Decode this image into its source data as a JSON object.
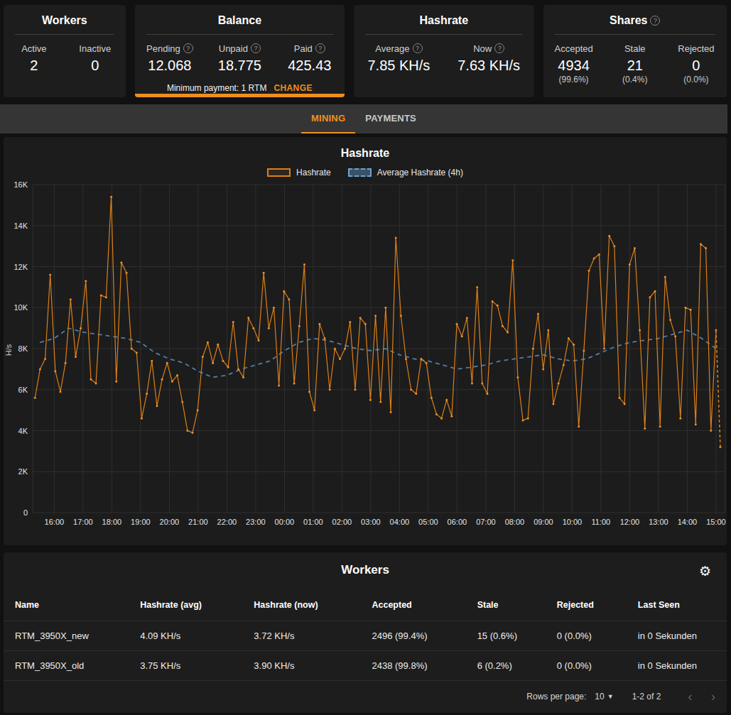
{
  "cards": {
    "workers": {
      "title": "Workers",
      "stats": [
        {
          "label": "Active",
          "value": "2"
        },
        {
          "label": "Inactive",
          "value": "0"
        }
      ]
    },
    "balance": {
      "title": "Balance",
      "stats": [
        {
          "label": "Pending",
          "value": "12.068",
          "help": true
        },
        {
          "label": "Unpaid",
          "value": "18.775",
          "help": true
        },
        {
          "label": "Paid",
          "value": "425.43",
          "help": true
        }
      ],
      "minimum_label": "Minimum payment: 1 RTM",
      "change_label": "CHANGE"
    },
    "hashrate": {
      "title": "Hashrate",
      "stats": [
        {
          "label": "Average",
          "value": "7.85 KH/s",
          "help": true
        },
        {
          "label": "Now",
          "value": "7.63 KH/s",
          "help": true
        }
      ]
    },
    "shares": {
      "title": "Shares",
      "title_help": true,
      "stats": [
        {
          "label": "Accepted",
          "value": "4934",
          "sub": "(99.6%)"
        },
        {
          "label": "Stale",
          "value": "21",
          "sub": "(0.4%)"
        },
        {
          "label": "Rejected",
          "value": "0",
          "sub": "(0.0%)"
        }
      ]
    }
  },
  "tabs": [
    {
      "label": "MINING",
      "active": true
    },
    {
      "label": "PAYMENTS",
      "active": false
    }
  ],
  "chart_data": {
    "type": "line",
    "title": "Hashrate",
    "ylabel": "H/s",
    "ylim": [
      0,
      16000
    ],
    "ytick_labels": [
      "0",
      "2K",
      "4K",
      "6K",
      "8K",
      "10K",
      "12K",
      "14K",
      "16K"
    ],
    "xtick_labels": [
      "16:00",
      "17:00",
      "18:00",
      "19:00",
      "20:00",
      "21:00",
      "22:00",
      "23:00",
      "00:00",
      "01:00",
      "02:00",
      "03:00",
      "04:00",
      "05:00",
      "06:00",
      "07:00",
      "08:00",
      "09:00",
      "10:00",
      "11:00",
      "12:00",
      "13:00",
      "14:00",
      "15:00"
    ],
    "xtick_hours": [
      16,
      17,
      18,
      19,
      20,
      21,
      22,
      23,
      24,
      25,
      26,
      27,
      28,
      29,
      30,
      31,
      32,
      33,
      34,
      35,
      36,
      37,
      38,
      39
    ],
    "legend": [
      {
        "label": "Hashrate",
        "color": "#dd7f17",
        "dashed": false
      },
      {
        "label": "Average Hashrate (4h)",
        "color": "#5487b8",
        "dashed": true
      }
    ],
    "series": [
      {
        "name": "Hashrate",
        "color": "#dd7f17",
        "t_start": 15.33,
        "t_end": 39.0,
        "unit": "H/s",
        "values_khs": [
          5.6,
          7.0,
          7.5,
          11.6,
          6.9,
          5.9,
          7.3,
          10.4,
          7.6,
          9.0,
          11.3,
          6.5,
          6.3,
          10.6,
          10.5,
          15.4,
          6.4,
          12.2,
          11.7,
          8.0,
          7.8,
          4.6,
          5.8,
          7.4,
          5.2,
          6.5,
          7.3,
          6.4,
          6.7,
          5.4,
          4.0,
          3.9,
          5.0,
          7.6,
          8.3,
          7.3,
          8.2,
          7.4,
          7.1,
          9.3,
          7.0,
          6.6,
          9.5,
          9.0,
          8.4,
          11.7,
          9.0,
          10.0,
          6.2,
          10.8,
          10.4,
          6.3,
          9.1,
          12.1,
          5.9,
          5.0,
          9.2,
          8.5,
          6.0,
          8.0,
          7.5,
          8.0,
          9.3,
          6.0,
          9.5,
          9.2,
          5.5,
          9.6,
          5.4,
          10.0,
          4.9,
          13.4,
          9.6,
          7.5,
          6.0,
          5.8,
          7.5,
          7.3,
          5.6,
          4.8,
          4.6,
          5.5,
          4.7,
          9.2,
          8.6,
          9.5,
          6.3,
          11.0,
          6.3,
          5.8,
          10.3,
          10.1,
          9.1,
          8.8,
          12.3,
          6.6,
          4.5,
          4.6,
          8.0,
          9.7,
          7.0,
          8.9,
          5.3,
          6.3,
          7.2,
          8.5,
          8.2,
          4.2,
          7.9,
          11.8,
          12.4,
          12.6,
          8.0,
          13.5,
          13.0,
          5.6,
          5.3,
          12.1,
          12.9,
          8.9,
          4.1,
          10.5,
          10.8,
          4.2,
          11.5,
          9.4,
          8.6,
          4.6,
          10.0,
          9.9,
          4.3,
          13.1,
          12.9,
          4.0,
          8.9
        ]
      },
      {
        "name": "Average Hashrate (4h)",
        "color": "#4d7fad",
        "dashed": true,
        "t_start": 15.5,
        "t_step": 0.5,
        "values_khs": [
          8.3,
          8.5,
          9.0,
          8.8,
          8.7,
          8.6,
          8.5,
          8.3,
          7.8,
          7.5,
          7.3,
          6.9,
          6.6,
          6.7,
          7.0,
          7.2,
          7.4,
          7.9,
          8.3,
          8.5,
          8.4,
          8.2,
          8.0,
          7.9,
          8.0,
          7.7,
          7.5,
          7.4,
          7.2,
          7.0,
          7.1,
          7.2,
          7.4,
          7.5,
          7.6,
          7.7,
          7.5,
          7.4,
          7.5,
          7.8,
          8.1,
          8.3,
          8.4,
          8.5,
          8.7,
          8.9,
          8.5,
          8.0
        ]
      }
    ],
    "trailing_dashed_point": {
      "t": 39.15,
      "value_khs": 3.2
    }
  },
  "workers_table": {
    "title": "Workers",
    "columns": [
      "Name",
      "Hashrate (avg)",
      "Hashrate (now)",
      "Accepted",
      "Stale",
      "Rejected",
      "Last Seen"
    ],
    "rows": [
      [
        "RTM_3950X_new",
        "4.09 KH/s",
        "3.72 KH/s",
        "2496 (99.4%)",
        "15 (0.6%)",
        "0 (0.0%)",
        "in 0 Sekunden"
      ],
      [
        "RTM_3950X_old",
        "3.75 KH/s",
        "3.90 KH/s",
        "2438 (99.8%)",
        "6 (0.2%)",
        "0 (0.0%)",
        "in 0 Sekunden"
      ]
    ],
    "pagination": {
      "rows_per_page_label": "Rows per page:",
      "rows_per_page": "10",
      "range": "1-2 of 2"
    }
  },
  "colors": {
    "accent": "#ef8e1e",
    "hashrate_line": "#dd7f17",
    "average_line": "#4d7fad",
    "card_bg": "#1d1d1d",
    "page_bg": "#111111",
    "tab_strip_bg": "#353535"
  }
}
